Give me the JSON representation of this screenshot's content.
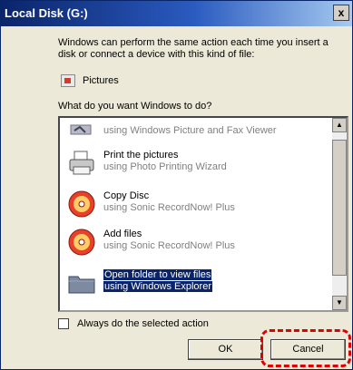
{
  "window": {
    "title": "Local Disk (G:)",
    "close_glyph": "x"
  },
  "description": "Windows can perform the same action each time you insert a disk or connect a device with this kind of file:",
  "content_type": {
    "label": "Pictures",
    "icon": "pictures-icon"
  },
  "question": "What do you want Windows to do?",
  "actions": [
    {
      "title": "",
      "subtitle": "using Windows Picture and Fax Viewer",
      "icon": "picture-viewer-icon"
    },
    {
      "title": "Print the pictures",
      "subtitle": "using Photo Printing Wizard",
      "icon": "printer-icon"
    },
    {
      "title": "Copy Disc",
      "subtitle": "using Sonic RecordNow! Plus",
      "icon": "disc-icon"
    },
    {
      "title": "Add files",
      "subtitle": "using Sonic RecordNow! Plus",
      "icon": "disc-icon"
    },
    {
      "title": "Open folder to view files",
      "subtitle": "using Windows Explorer",
      "icon": "folder-icon",
      "selected": true
    }
  ],
  "checkbox": {
    "label": "Always do the selected action",
    "checked": false
  },
  "buttons": {
    "ok": "OK",
    "cancel": "Cancel"
  },
  "colors": {
    "highlight": "#e00000",
    "selection": "#0a246a"
  }
}
